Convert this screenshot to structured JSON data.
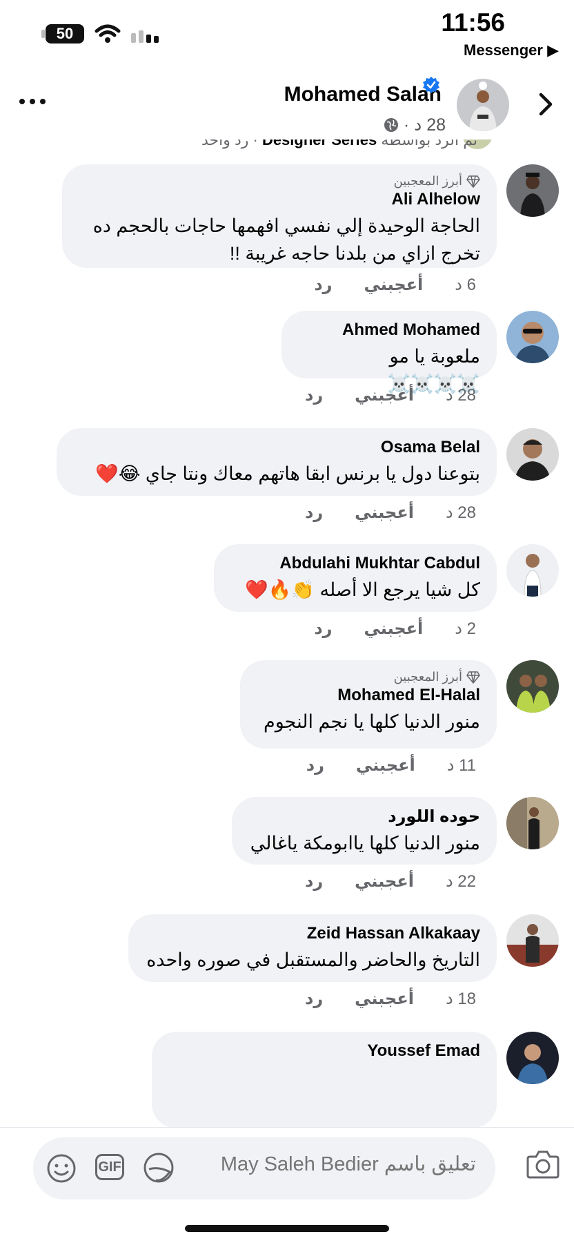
{
  "status_bar": {
    "time": "11:56",
    "battery": "50",
    "back_app": "Messenger ▶"
  },
  "header": {
    "name": "Mohamed Salah",
    "meta": "28 د ·"
  },
  "truncated_reply": {
    "text": "تم الرد بواسطة",
    "author": "Designer Series",
    "suffix": "· رد واحد"
  },
  "comments": [
    {
      "badge": "أبرز المعجبين",
      "author": "Ali Alhelow",
      "text": "الحاجة الوحيدة إلي نفسي افهمها حاجات بالحجم ده تخرج ازاي من بلدنا حاجه غريبة !!",
      "time": "6 د",
      "like": "أعجبني",
      "reply": "رد"
    },
    {
      "author": "Ahmed Mohamed",
      "text": "ملعوبة يا مو ☠️☠️☠️☠️",
      "time": "28 د",
      "like": "أعجبني",
      "reply": "رد"
    },
    {
      "author": "Osama Belal",
      "text": "بتوعنا دول يا برنس ابقا هاتهم معاك ونتا جاي 😂❤️",
      "time": "28 د",
      "like": "أعجبني",
      "reply": "رد"
    },
    {
      "author": "Abdulahi Mukhtar Cabdul",
      "text": "كل شيا يرجع الا أصله 👏🔥❤️",
      "time": "2 د",
      "like": "أعجبني",
      "reply": "رد"
    },
    {
      "badge": "أبرز المعجبين",
      "author": "Mohamed El-Halal",
      "text": "منور الدنيا كلها يا نجم النجوم",
      "time": "11 د",
      "like": "أعجبني",
      "reply": "رد"
    },
    {
      "author": "حوده اللورد",
      "text": "منور الدنيا كلها ياابومكة ياغالي",
      "time": "22 د",
      "like": "أعجبني",
      "reply": "رد"
    },
    {
      "author": "Zeid Hassan Alkakaay",
      "text": "التاريخ والحاضر والمستقبل في صوره واحده",
      "time": "18 د",
      "like": "أعجبني",
      "reply": "رد"
    },
    {
      "author": "Youssef Emad",
      "text": "",
      "time": "",
      "like": "",
      "reply": ""
    }
  ],
  "composer": {
    "placeholder": "تعليق باسم May Saleh Bedier",
    "gif_label": "GIF"
  },
  "colors": {
    "bubble": "#f0f2f5",
    "verified": "#1877f2",
    "secondary_text": "#65676b"
  }
}
